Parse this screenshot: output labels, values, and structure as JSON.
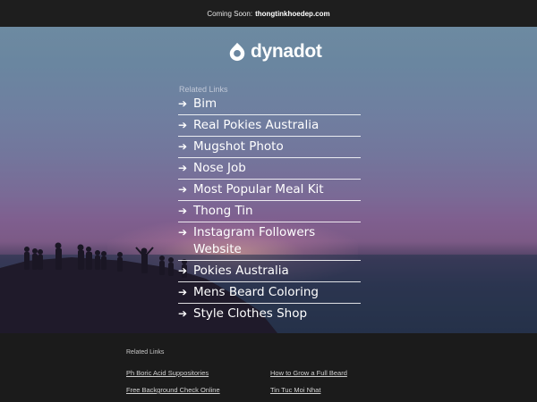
{
  "topbar": {
    "prefix": "Coming Soon:",
    "domain": "thongtinkhoedep.com"
  },
  "logo": {
    "text": "dynadot",
    "icon": "dynadot-logo-icon"
  },
  "related": {
    "heading": "Related Links",
    "arrow": "➔",
    "items": [
      {
        "label": "Bim"
      },
      {
        "label": "Real Pokies Australia"
      },
      {
        "label": "Mugshot Photo"
      },
      {
        "label": "Nose Job"
      },
      {
        "label": "Most Popular Meal Kit"
      },
      {
        "label": "Thong Tin"
      },
      {
        "label": "Instagram Followers Website"
      },
      {
        "label": "Pokies Australia"
      },
      {
        "label": "Mens Beard Coloring"
      },
      {
        "label": "Style Clothes Shop"
      }
    ]
  },
  "footer": {
    "heading": "Related Links",
    "links": [
      {
        "label": "Ph Boric Acid Suppositories"
      },
      {
        "label": "How to Grow a Full Beard"
      },
      {
        "label": "Free Background Check Online"
      },
      {
        "label": "Tin Tuc Moi Nhat"
      }
    ]
  },
  "colors": {
    "topbar_bg": "#1e1e1e",
    "footer_bg": "#1b1b1b",
    "link_text": "#ffffff"
  }
}
